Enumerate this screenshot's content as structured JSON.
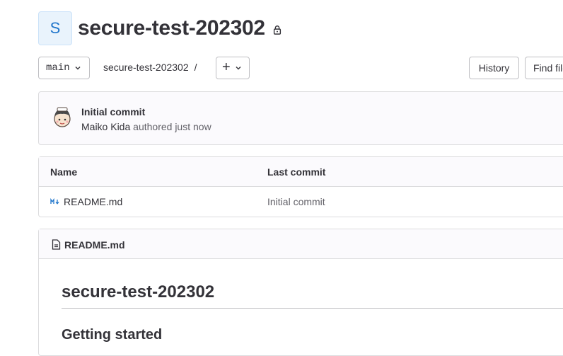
{
  "project": {
    "avatar_letter": "S",
    "title": "secure-test-202302",
    "visibility_icon": "lock-icon"
  },
  "toolbar": {
    "branch": "main",
    "breadcrumb_project": "secure-test-202302",
    "breadcrumb_separator": "/",
    "add_label": "+",
    "history_label": "History",
    "find_file_label": "Find file"
  },
  "last_commit": {
    "title": "Initial commit",
    "author": "Maiko Kida",
    "action": "authored just now"
  },
  "file_table": {
    "columns": [
      "Name",
      "Last commit"
    ],
    "rows": [
      {
        "name": "README.md",
        "last_commit": "Initial commit",
        "icon": "markdown-icon"
      }
    ]
  },
  "readme": {
    "file_name": "README.md",
    "heading": "secure-test-202302",
    "subheading": "Getting started"
  },
  "colors": {
    "accent": "#1f75cb",
    "border": "#dcdcde",
    "text": "#333238",
    "muted": "#626168"
  }
}
